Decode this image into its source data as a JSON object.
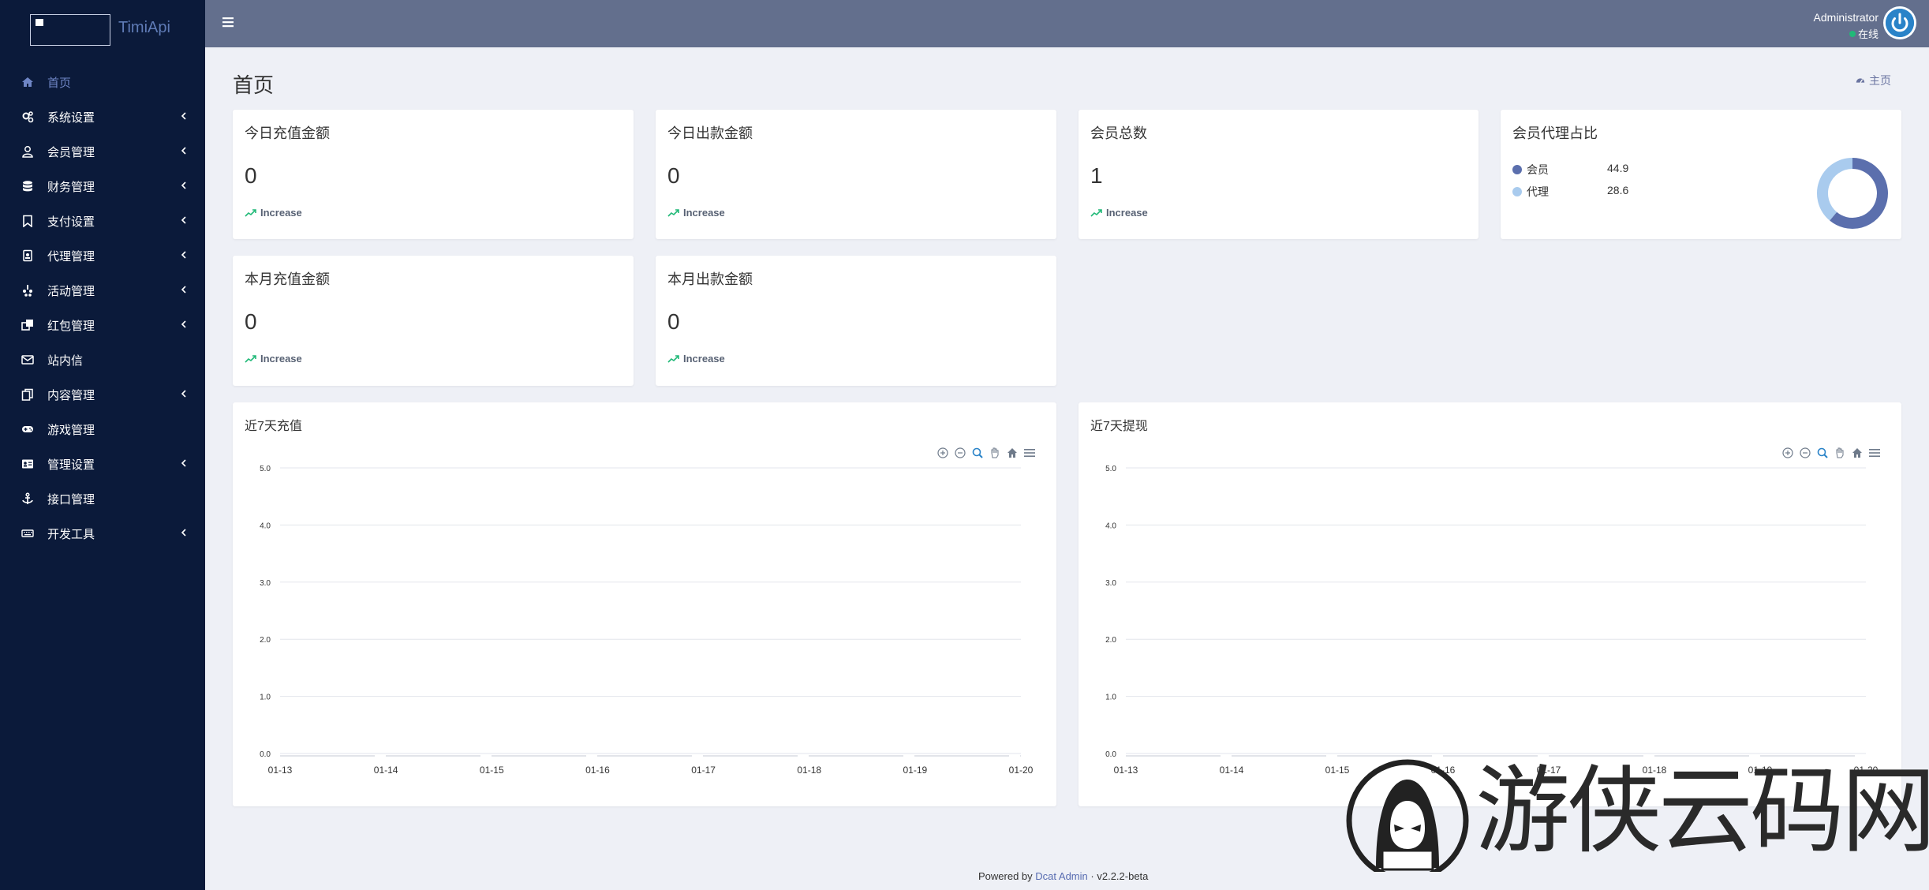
{
  "brand": {
    "name": "TimiApi"
  },
  "sidebar": {
    "items": [
      {
        "label": "首页",
        "icon": "home-icon",
        "active": true,
        "chevron": false
      },
      {
        "label": "系统设置",
        "icon": "cogs-icon",
        "chevron": true
      },
      {
        "label": "会员管理",
        "icon": "user-icon",
        "chevron": true
      },
      {
        "label": "财务管理",
        "icon": "database-icon",
        "chevron": true
      },
      {
        "label": "支付设置",
        "icon": "bookmark-icon",
        "chevron": true
      },
      {
        "label": "代理管理",
        "icon": "id-badge-icon",
        "chevron": true
      },
      {
        "label": "活动管理",
        "icon": "yelp-icon",
        "chevron": true
      },
      {
        "label": "红包管理",
        "icon": "clone-icon",
        "chevron": true
      },
      {
        "label": "站内信",
        "icon": "envelope-icon",
        "chevron": false
      },
      {
        "label": "内容管理",
        "icon": "copy-icon",
        "chevron": true
      },
      {
        "label": "游戏管理",
        "icon": "gamepad-icon",
        "chevron": false
      },
      {
        "label": "管理设置",
        "icon": "address-card-icon",
        "chevron": true
      },
      {
        "label": "接口管理",
        "icon": "anchor-icon",
        "chevron": false
      },
      {
        "label": "开发工具",
        "icon": "keyboard-icon",
        "chevron": true
      }
    ]
  },
  "header": {
    "user_name": "Administrator",
    "user_status": "在线"
  },
  "page": {
    "title": "首页",
    "breadcrumb": "主页"
  },
  "cards": [
    {
      "title": "今日充值金额",
      "value": "0",
      "trend": "Increase"
    },
    {
      "title": "今日出款金额",
      "value": "0",
      "trend": "Increase"
    },
    {
      "title": "会员总数",
      "value": "1",
      "trend": "Increase"
    },
    {
      "title": "本月充值金额",
      "value": "0",
      "trend": "Increase"
    },
    {
      "title": "本月出款金额",
      "value": "0",
      "trend": "Increase"
    }
  ],
  "ratio_card": {
    "title": "会员代理占比",
    "legend": [
      {
        "name": "会员",
        "value": "44.9",
        "color": "#5b6fad"
      },
      {
        "name": "代理",
        "value": "28.6",
        "color": "#a9cbee"
      }
    ]
  },
  "chart_data": [
    {
      "type": "line",
      "title": "近7天充值",
      "x": [
        "01-13",
        "01-14",
        "01-15",
        "01-16",
        "01-17",
        "01-18",
        "01-19",
        "01-20"
      ],
      "series": [
        {
          "values": [
            0,
            0,
            0,
            0,
            0,
            0,
            0,
            0
          ]
        }
      ],
      "yticks": [
        "0.0",
        "1.0",
        "2.0",
        "3.0",
        "4.0",
        "5.0"
      ],
      "ylim": [
        0,
        5
      ],
      "grid": true
    },
    {
      "type": "line",
      "title": "近7天提现",
      "x": [
        "01-13",
        "01-14",
        "01-15",
        "01-16",
        "01-17",
        "01-18",
        "01-19",
        "01-20"
      ],
      "series": [
        {
          "values": [
            0,
            0,
            0,
            0,
            0,
            0,
            0,
            0
          ]
        }
      ],
      "yticks": [
        "0.0",
        "1.0",
        "2.0",
        "3.0",
        "4.0",
        "5.0"
      ],
      "ylim": [
        0,
        5
      ],
      "grid": true
    }
  ],
  "footer": {
    "prefix": "Powered by",
    "link": "Dcat Admin",
    "sep": "·",
    "version": "v2.2.2-beta"
  },
  "watermark": {
    "text": "游侠云码网"
  },
  "colors": {
    "sidebar_bg": "#0b1a3a",
    "topbar_bg": "#636f8d",
    "accent": "#586cb1",
    "donut_primary": "#5b6fad",
    "donut_secondary": "#a9cbee"
  }
}
